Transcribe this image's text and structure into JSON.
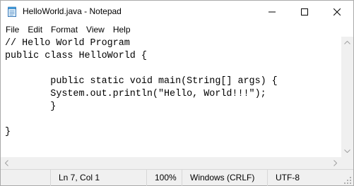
{
  "window": {
    "title": "HelloWorld.java - Notepad",
    "app_icon": "notepad-icon",
    "controls": [
      "minimize-icon",
      "maximize-icon",
      "close-icon"
    ]
  },
  "menu": {
    "items": [
      "File",
      "Edit",
      "Format",
      "View",
      "Help"
    ]
  },
  "editor": {
    "lines": [
      "// Hello World Program",
      "public class HelloWorld {",
      "",
      "        public static void main(String[] args) {",
      "        System.out.println(\"Hello, World!!!\");",
      "        }",
      "",
      "}"
    ]
  },
  "status": {
    "position": "Ln 7, Col 1",
    "zoom": "100%",
    "line_endings": "Windows (CRLF)",
    "encoding": "UTF-8"
  },
  "colors": {
    "background": "#ffffff",
    "chrome": "#f0f0f0",
    "text": "#000000"
  }
}
